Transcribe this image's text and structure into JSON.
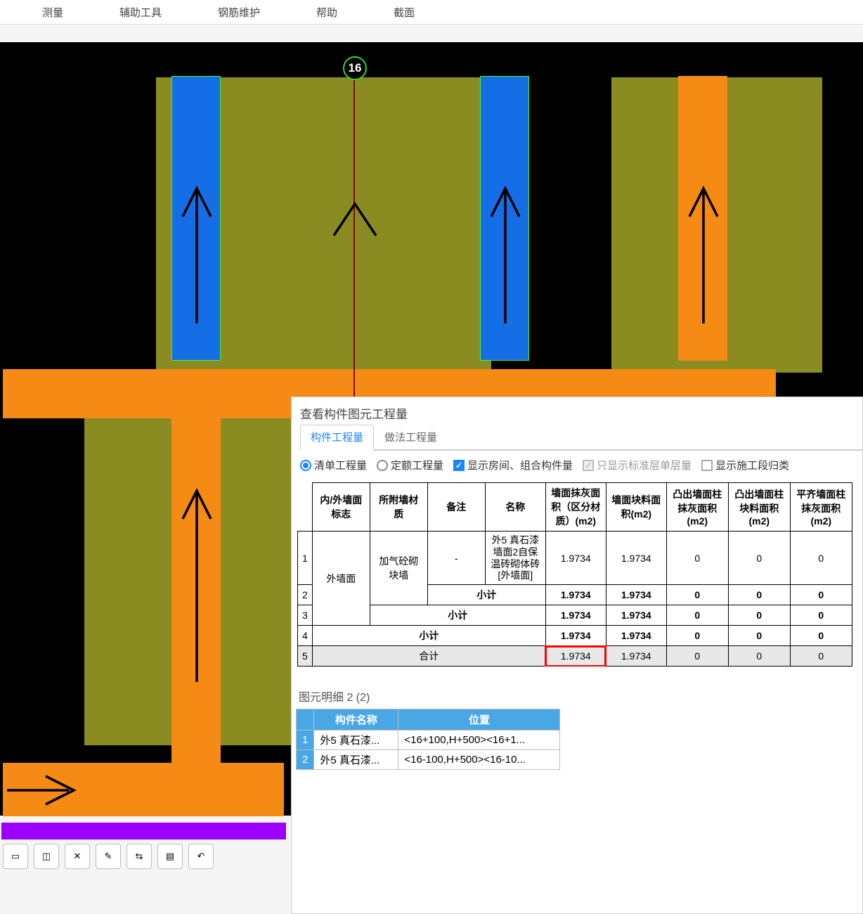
{
  "menubar": [
    "测量",
    "辅助工具",
    "钢筋维护",
    "帮助",
    "截面"
  ],
  "axis_label": "16",
  "panel": {
    "title": "查看构件图元工程量",
    "tabs": [
      "构件工程量",
      "做法工程量"
    ],
    "active_tab": 0,
    "radios": {
      "list_qty": "清单工程量",
      "quota_qty": "定额工程量"
    },
    "checks": {
      "show_room": "显示房间、组合构件量",
      "show_std_single": "只显示标准层单层量",
      "show_constr_seg": "显示施工段归类"
    },
    "headers": [
      "内/外墙面标志",
      "所附墙材质",
      "备注",
      "名称",
      "墙面抹灰面积（区分材质）(m2)",
      "墙面块料面积(m2)",
      "凸出墙面柱抹灰面积(m2)",
      "凸出墙面柱块料面积(m2)",
      "平齐墙面柱抹灰面积(m2)"
    ],
    "rows": [
      {
        "idx": "1",
        "flag": "外墙面",
        "mat": "加气砼砌块墙",
        "note": "-",
        "name": "外5 真石漆墙面2自保温砖砌体砖 [外墙面]",
        "v1": "1.9734",
        "v2": "1.9734",
        "v3": "0",
        "v4": "0",
        "v5": "0"
      },
      {
        "idx": "2",
        "name": "小计",
        "v1": "1.9734",
        "v2": "1.9734",
        "v3": "0",
        "v4": "0",
        "v5": "0",
        "bold": true
      },
      {
        "idx": "3",
        "name": "小计",
        "span": "mat",
        "v1": "1.9734",
        "v2": "1.9734",
        "v3": "0",
        "v4": "0",
        "v5": "0",
        "bold": true
      },
      {
        "idx": "4",
        "name": "小计",
        "span": "flag",
        "v1": "1.9734",
        "v2": "1.9734",
        "v3": "0",
        "v4": "0",
        "v5": "0",
        "bold": true
      },
      {
        "idx": "5",
        "name": "合计",
        "span": "all",
        "v1": "1.9734",
        "v2": "1.9734",
        "v3": "0",
        "v4": "0",
        "v5": "0",
        "total": true
      }
    ]
  },
  "detail": {
    "title": "图元明细 2 (2)",
    "headers": [
      "构件名称",
      "位置"
    ],
    "rows": [
      {
        "idx": "1",
        "name": "外5 真石漆...",
        "pos": "<16+100,H+500><16+1..."
      },
      {
        "idx": "2",
        "name": "外5 真石漆...",
        "pos": "<16-100,H+500><16-10..."
      }
    ]
  }
}
